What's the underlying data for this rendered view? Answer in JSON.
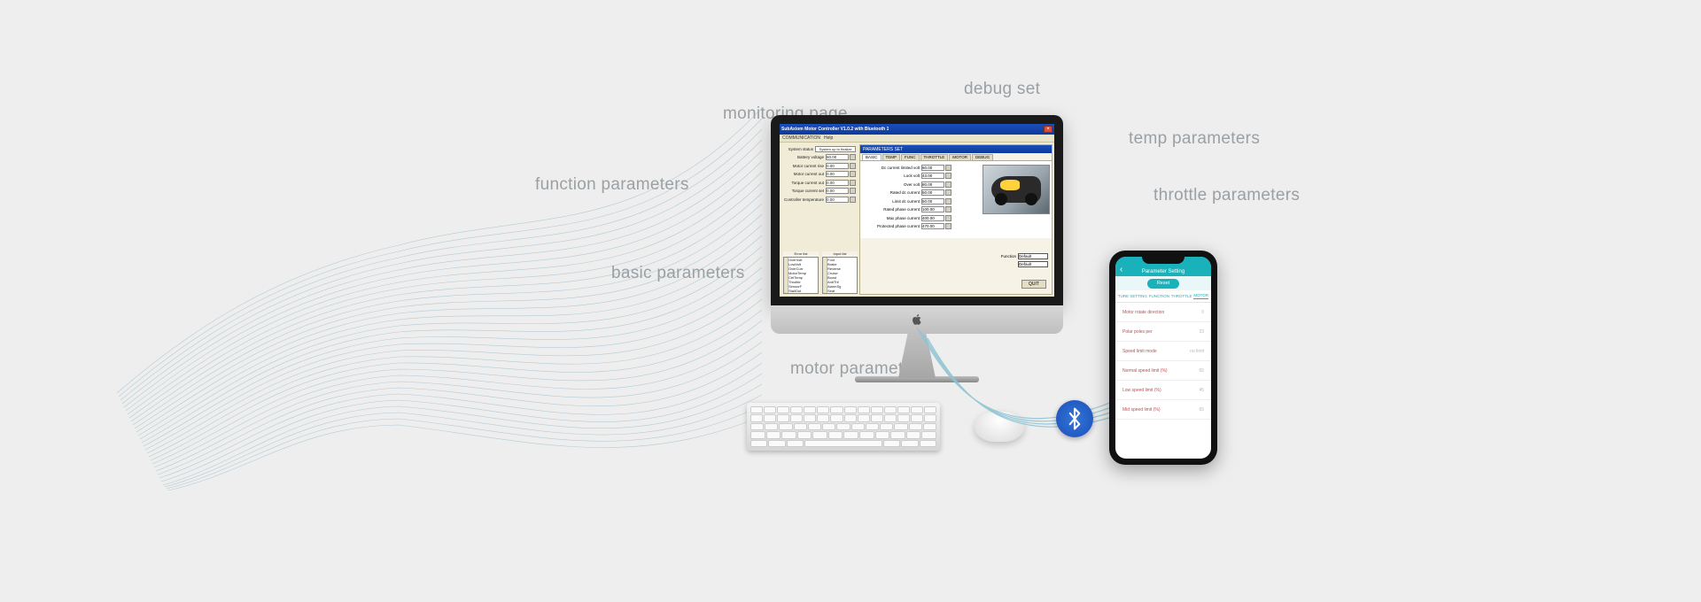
{
  "labels": {
    "debug_set": "debug set",
    "monitoring_page": "monitoring page",
    "temp_parameters": "temp parameters",
    "function_parameters": "function parameters",
    "throttle_parameters": "throttle parameters",
    "basic_parameters": "basic parameters",
    "motor_parameters": "motor parameters"
  },
  "desktop_app": {
    "title": "SubAxiom Motor Controller V1.0.2 with Bluetooth 1",
    "menus": [
      "COMMUNICATION",
      "Help"
    ],
    "panel_title": "PARAMETERS SET",
    "tabs": [
      "BASIC",
      "TEMP",
      "FUNC",
      "THROTTLE",
      "MOTOR",
      "DEBUG"
    ],
    "active_tab": "BASIC",
    "left_fields": [
      {
        "label": "System status",
        "input": "System up to finalize"
      },
      {
        "label": "Battery voltage",
        "value": "60.00"
      },
      {
        "label": "Motor current rise",
        "value": "0.00"
      },
      {
        "label": "Motor current out",
        "value": "0.00"
      },
      {
        "label": "Torque current out",
        "value": "0.00"
      },
      {
        "label": "Torque current set",
        "value": "0.00"
      },
      {
        "label": "Controller temperature",
        "value": "0.00"
      }
    ],
    "basic_fields": [
      {
        "label": "Dc current limited volt",
        "value": "60.00"
      },
      {
        "label": "Lock volt",
        "value": "43.00"
      },
      {
        "label": "Over volt",
        "value": "80.00"
      },
      {
        "label": "Rated dc current",
        "value": "50.00"
      },
      {
        "label": "Limit dc current",
        "value": "50.00"
      },
      {
        "label": "Rated phase current",
        "value": "100.00"
      },
      {
        "label": "Max phase current",
        "value": "400.00"
      },
      {
        "label": "Protected phase current",
        "value": "470.00"
      }
    ],
    "readout_title_left": "Error list",
    "readout_title_right": "Input list",
    "readout_left_items": [
      "OverVolt",
      "LowVolt",
      "OverCurr",
      "MotorTemp",
      "CtrlTemp",
      "Throttle",
      "SensorF",
      "StallOut"
    ],
    "readout_right_items": [
      "Foot",
      "Brake",
      "Reverse",
      "Cruise",
      "Boost",
      "AntiThf",
      "AlarmSg",
      "Seat"
    ],
    "function_label": "Function",
    "function_value": "Default",
    "quit_label": "QUIT"
  },
  "mobile_app": {
    "header_back": "‹",
    "header_title": "Parameter Setting",
    "header_right": "",
    "reset_label": "Reset",
    "tabs": [
      "TURE SETTING",
      "FUNCTION",
      "THROTTLE",
      "MOTOR"
    ],
    "active_tab": "MOTOR",
    "rows": [
      {
        "label": "Motor rotate direction",
        "value": "0"
      },
      {
        "label": "Polar poles per",
        "value": "23"
      },
      {
        "label": "Speed limit mode",
        "value": "no limit"
      },
      {
        "label": "Normal speed limit (%)",
        "value": "65"
      },
      {
        "label": "Low speed limit (%)",
        "value": "45"
      },
      {
        "label": "Mid speed limit (%)",
        "value": "65"
      }
    ]
  },
  "icons": {
    "bluetooth": "bluetooth"
  }
}
